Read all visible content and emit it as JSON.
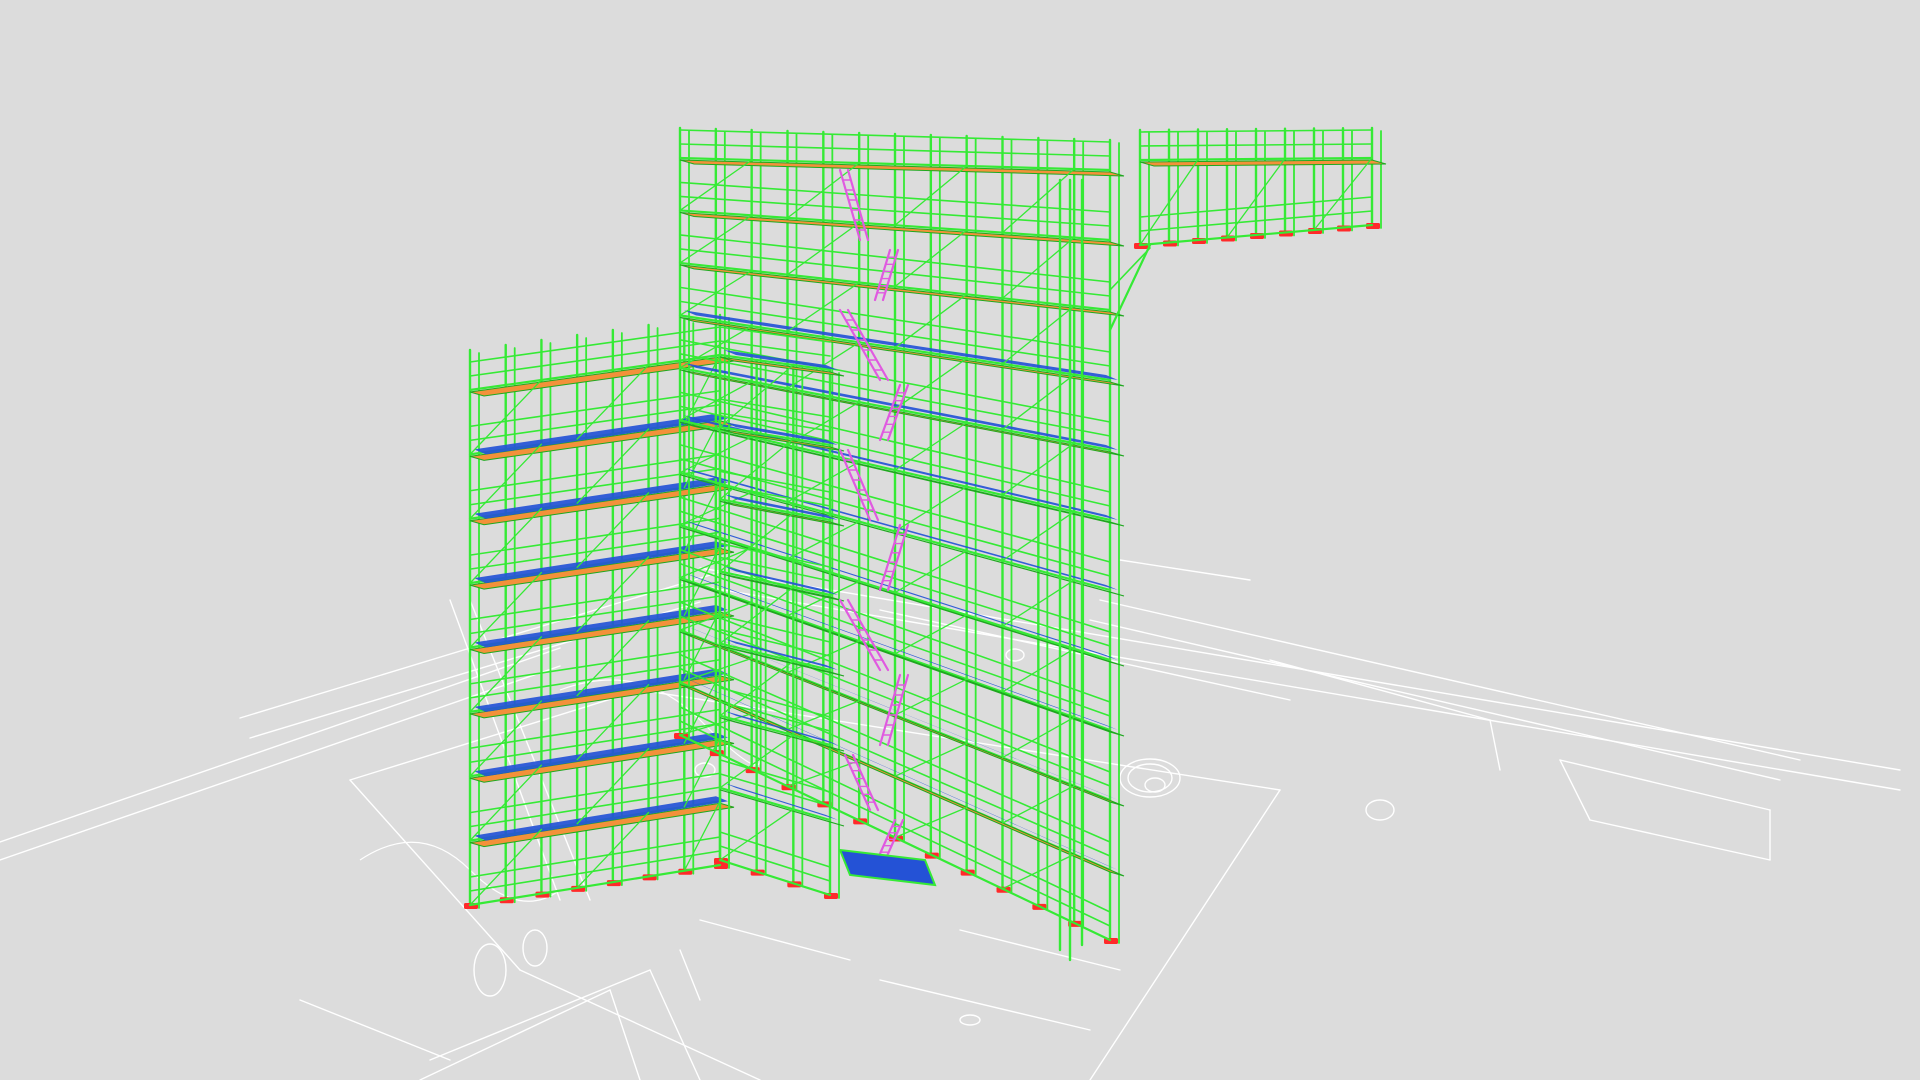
{
  "scene": {
    "type": "3d-scaffold-model-viewer",
    "background": "#dcdcdc",
    "colors": {
      "frame": "#35ea35",
      "frame_dark": "#1fa81f",
      "deck_timber": "#f3913a",
      "deck_steel": "#2452d6",
      "ladder": "#e05ae0",
      "base_plate": "#ff2a2a",
      "floorplan_line": "#ffffff"
    },
    "labels": []
  }
}
